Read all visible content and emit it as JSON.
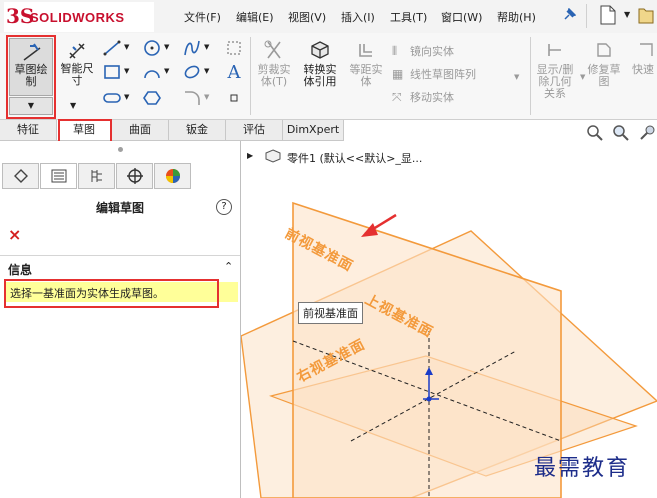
{
  "app": {
    "logo_mark": "3S",
    "logo_text": "SOLIDWORKS"
  },
  "menu": [
    "文件(F)",
    "编辑(E)",
    "视图(V)",
    "插入(I)",
    "工具(T)",
    "窗口(W)",
    "帮助(H)"
  ],
  "ribbon": {
    "sketch_label": "草图绘\n制",
    "smart_dim_label": "智能尺\n寸",
    "trim_label": "剪裁实\n体(T)",
    "convert_label": "转换实\n体引用",
    "offset_label": "等距实\n体",
    "mirror_label": "镜向实体",
    "linear_pattern_label": "线性草图阵列",
    "move_label": "移动实体",
    "show_relations_label": "显示/删\n除几何\n关系",
    "repair_label": "修复草\n图",
    "quick_label": "快速"
  },
  "tabs": [
    "特征",
    "草图",
    "曲面",
    "钣金",
    "评估",
    "DimXpert"
  ],
  "active_tab": "草图",
  "tree": {
    "root_label": "零件1 (默认<<默认>_显..."
  },
  "panel": {
    "title": "编辑草图",
    "help_icon": "?",
    "close_icon": "×",
    "info_header": "信息",
    "info_text": "选择一基准面为实体生成草图。"
  },
  "viewport": {
    "front_plane": "前视基准面",
    "top_plane": "上视基准面",
    "right_plane": "右视基准面",
    "tooltip": "前视基准面"
  },
  "watermark": "最需教育",
  "colors": {
    "accent_red": "#e53030",
    "plane_orange": "#f39a3c",
    "logo_red": "#c8102e",
    "info_yellow": "#ffff99"
  }
}
